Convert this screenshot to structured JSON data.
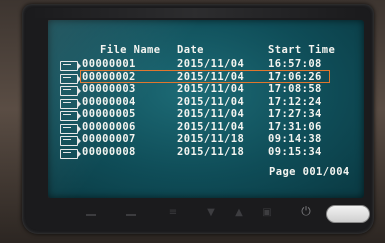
{
  "header": {
    "file_name": "File Name",
    "date": "Date",
    "start_time": "Start Time"
  },
  "files": [
    {
      "name": "00000001",
      "date": "2015/11/04",
      "time": "16:57:08"
    },
    {
      "name": "00000002",
      "date": "2015/11/04",
      "time": "17:06:26"
    },
    {
      "name": "00000003",
      "date": "2015/11/04",
      "time": "17:08:58"
    },
    {
      "name": "00000004",
      "date": "2015/11/04",
      "time": "17:12:24"
    },
    {
      "name": "00000005",
      "date": "2015/11/04",
      "time": "17:27:34"
    },
    {
      "name": "00000006",
      "date": "2015/11/04",
      "time": "17:31:06"
    },
    {
      "name": "00000007",
      "date": "2015/11/18",
      "time": "09:14:38"
    },
    {
      "name": "00000008",
      "date": "2015/11/18",
      "time": "09:15:34"
    }
  ],
  "selected_index": 1,
  "page_indicator": "Page 001/004",
  "buttons": [
    {
      "icon": "minus-icon"
    },
    {
      "icon": "plus-icon"
    },
    {
      "icon": "menu-icon"
    },
    {
      "icon": "down-arrow-icon"
    },
    {
      "icon": "up-arrow-icon"
    },
    {
      "icon": "mode-icon"
    },
    {
      "icon": "power-icon"
    },
    {
      "icon": "oval-button"
    }
  ],
  "colors": {
    "screen": "#0f4d58",
    "text": "#f4f4f0",
    "selection": "#e0762d"
  }
}
